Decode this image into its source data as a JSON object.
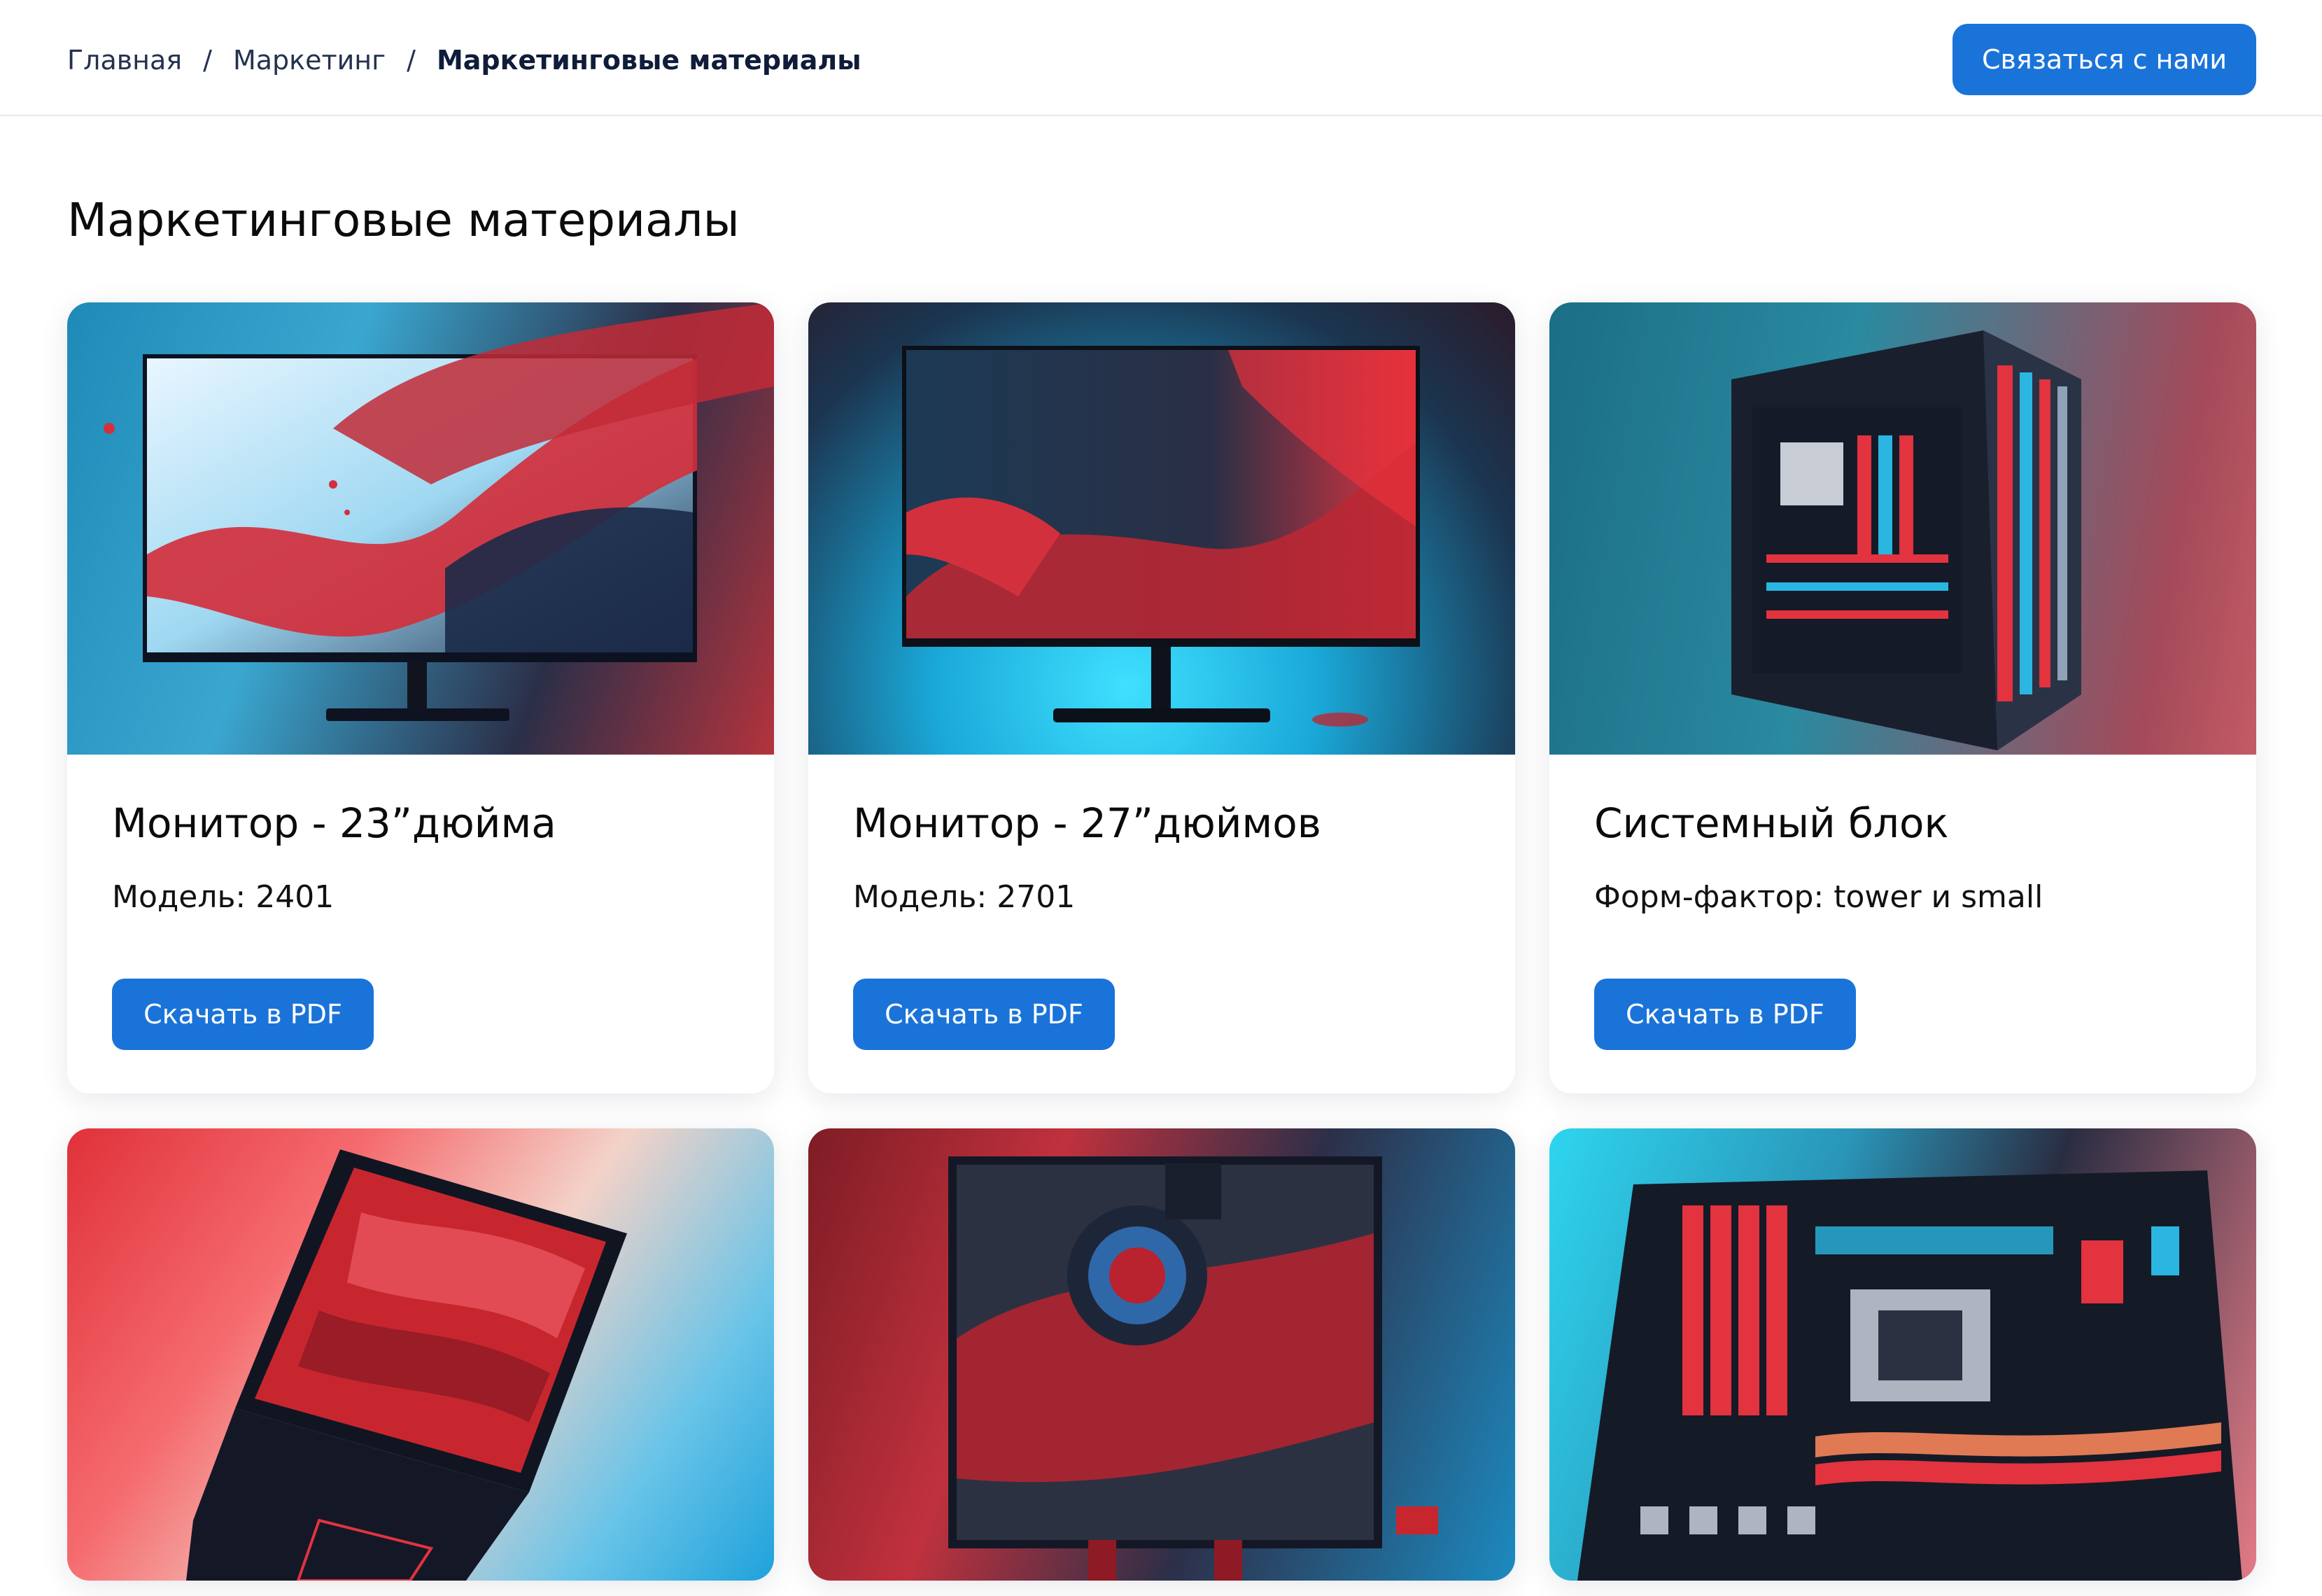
{
  "breadcrumb": {
    "items": [
      "Главная",
      "Маркетинг",
      "Маркетинговые материалы"
    ],
    "separator": "/"
  },
  "header": {
    "contact_label": "Связаться с нами"
  },
  "page": {
    "title": "Маркетинговые материалы"
  },
  "cards": [
    {
      "title": "Монитор - 23”дюйма",
      "subtitle": "Модель: 2401",
      "button": "Скачать в PDF",
      "image": "monitor-23-image"
    },
    {
      "title": "Монитор - 27”дюймов",
      "subtitle": "Модель: 2701",
      "button": "Скачать в PDF",
      "image": "monitor-27-image"
    },
    {
      "title": "Системный блок",
      "subtitle": "Форм-фактор: tower и small",
      "button": "Скачать в PDF",
      "image": "system-unit-image"
    },
    {
      "image": "laptop-image"
    },
    {
      "image": "monitor-image"
    },
    {
      "image": "motherboard-image"
    }
  ],
  "colors": {
    "accent": "#1a73d9",
    "text": "#0b0b0b",
    "breadcrumb": "#24324f",
    "divider": "#e6e8ec"
  }
}
